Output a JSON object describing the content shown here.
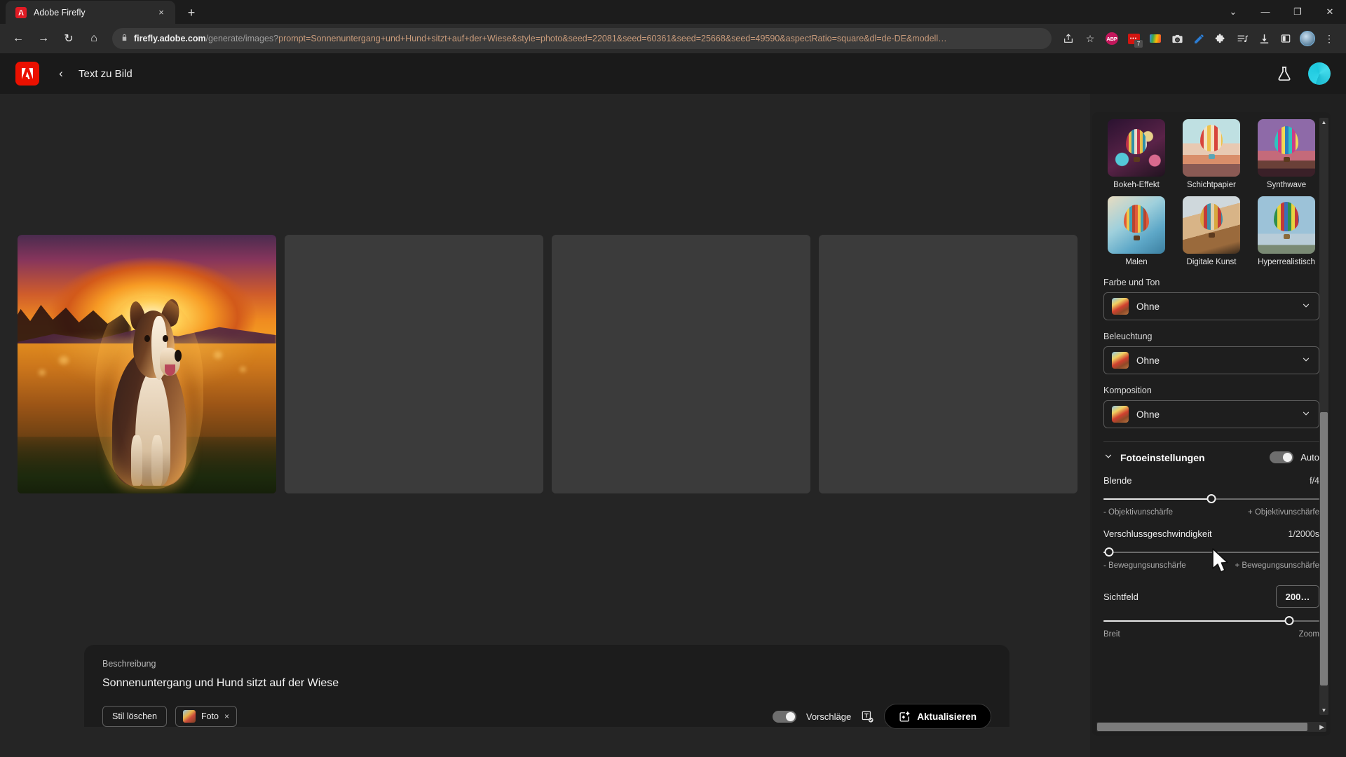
{
  "browser": {
    "tab": {
      "title": "Adobe Firefly",
      "favicon": "adobe-icon",
      "close": "×"
    },
    "new_tab": "+",
    "window_controls": {
      "tablist": "⌄",
      "minimize": "—",
      "maximize": "❐",
      "close": "✕"
    },
    "nav": {
      "back": "←",
      "forward": "→",
      "reload": "↻",
      "home": "⌂"
    },
    "url": {
      "lock": "🔒",
      "domain": "firefly.adobe.com",
      "path": "/generate/images?",
      "query": "prompt=Sonnenuntergang+und+Hund+sitzt+auf+der+Wiese&style=photo&seed=22081&seed=60361&seed=25668&seed=49590&aspectRatio=square&dl=de-DE&modell…"
    },
    "extensions": {
      "share": "share-icon",
      "bookmark": "☆",
      "abp": "ABP",
      "ublock_badge": "7",
      "camera": "camera-icon",
      "pen": "pen-icon",
      "puzzle": "puzzle-icon",
      "playlist": "playlist-icon",
      "download": "download-icon",
      "sidebar": "sidebar-icon",
      "menu": "⋮"
    }
  },
  "app": {
    "logo": "adobe-logo",
    "back": "‹",
    "title": "Text zu Bild",
    "beaker_icon": "beaker-icon",
    "avatar": "user-avatar"
  },
  "results": {
    "cards": [
      {
        "state": "filled",
        "alt": "Hund im Sonnenuntergang auf der Wiese"
      },
      {
        "state": "empty",
        "alt": ""
      },
      {
        "state": "empty",
        "alt": ""
      },
      {
        "state": "empty",
        "alt": ""
      }
    ]
  },
  "prompt_panel": {
    "label": "Beschreibung",
    "text": "Sonnenuntergang und Hund sitzt auf der Wiese",
    "clear_style_button": "Stil löschen",
    "style_chip": {
      "label": "Foto",
      "remove": "×"
    },
    "suggestions": {
      "label": "Vorschläge",
      "state": "on",
      "icon": "text-suggestion-icon"
    },
    "refresh_button": {
      "label": "Aktualisieren",
      "icon": "sparkle-icon"
    }
  },
  "right_panel": {
    "styles": [
      {
        "name": "Bokeh-Effekt"
      },
      {
        "name": "Schichtpapier"
      },
      {
        "name": "Synthwave"
      },
      {
        "name": "Malen"
      },
      {
        "name": "Digitale Kunst"
      },
      {
        "name": "Hyperrealistisch"
      }
    ],
    "dropdowns": [
      {
        "label": "Farbe und Ton",
        "value": "Ohne",
        "chevron": "⌄"
      },
      {
        "label": "Beleuchtung",
        "value": "Ohne",
        "chevron": "⌄"
      },
      {
        "label": "Komposition",
        "value": "Ohne",
        "chevron": "⌄"
      }
    ],
    "photo_settings": {
      "chevron": "⌄",
      "title": "Fotoeinstellungen",
      "auto_label": "Auto",
      "auto_state": "on",
      "aperture": {
        "name": "Blende",
        "value": "f/4",
        "min_label": "- Objektivunschärfe",
        "max_label": "+ Objektivunschärfe",
        "position_pct": 50
      },
      "shutter": {
        "name": "Verschlussgeschwindigkeit",
        "value": "1/2000s",
        "min_label": "- Bewegungsunschärfe",
        "max_label": "+ Bewegungsunschärfe",
        "position_pct": 2
      },
      "field_of_view": {
        "name": "Sichtfeld",
        "value": "200…",
        "min_label": "Breit",
        "max_label": "Zoom",
        "position_pct": 86
      }
    }
  },
  "colors": {
    "accent_red": "#eb1000",
    "panel_bg": "#1e1e1e",
    "canvas_bg": "#252525",
    "avatar_cyan": "#2fd4e8"
  }
}
